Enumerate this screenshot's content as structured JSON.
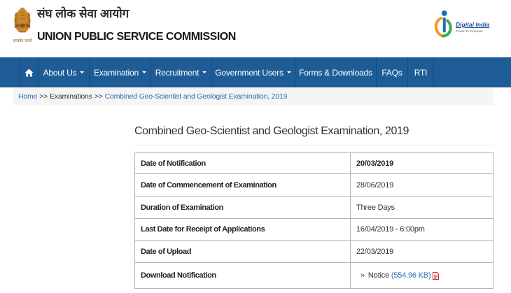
{
  "theme": {
    "nav_bg": "#1e5c96",
    "link_color": "#2a6db5",
    "breadcrumb_bg": "#f5f5f5",
    "emblem_color": "#c9872e",
    "pdf_icon_color": "#d9221c"
  },
  "header": {
    "emblem": {
      "icon": "national-emblem-icon",
      "motto": "सत्यमेव जयते"
    },
    "title_hindi": "संघ लोक सेवा आयोग",
    "title_english": "UNION PUBLIC SERVICE COMMISSION",
    "digital_india": {
      "icon": "digital-india-logo",
      "title": "Digital India",
      "tagline": "Power To Empower"
    }
  },
  "nav": {
    "home_icon": "home-icon",
    "items": [
      {
        "label": "About Us",
        "has_dropdown": true
      },
      {
        "label": "Examination",
        "has_dropdown": true
      },
      {
        "label": "Recruitment",
        "has_dropdown": true
      },
      {
        "label": "Government Users",
        "has_dropdown": true
      },
      {
        "label": "Forms & Downloads",
        "has_dropdown": false
      },
      {
        "label": "FAQs",
        "has_dropdown": false
      },
      {
        "label": "RTI",
        "has_dropdown": false
      }
    ]
  },
  "breadcrumb": {
    "separator": ">>",
    "items": [
      {
        "label": "Home",
        "is_link": true
      },
      {
        "label": "Examinations",
        "is_link": false
      },
      {
        "label": "Combined Geo-Scientist and Geologist Examination, 2019",
        "is_link": true
      }
    ]
  },
  "main": {
    "title": "Combined Geo-Scientist and Geologist Examination, 2019",
    "details": [
      {
        "label": "Date of Notification",
        "value": "20/03/2019"
      },
      {
        "label": "Date of Commencement of Examination",
        "value": "28/06/2019"
      },
      {
        "label": "Duration of Examination",
        "value": "Three Days"
      },
      {
        "label": "Last Date for Receipt of Applications",
        "value": "16/04/2019 - 6:00pm"
      },
      {
        "label": "Date of Upload",
        "value": "22/03/2019"
      }
    ],
    "download": {
      "label": "Download Notification",
      "bullet": "»",
      "link_text": "Notice",
      "file_size": "(554.96 KB)",
      "file_icon": "pdf-icon"
    }
  }
}
